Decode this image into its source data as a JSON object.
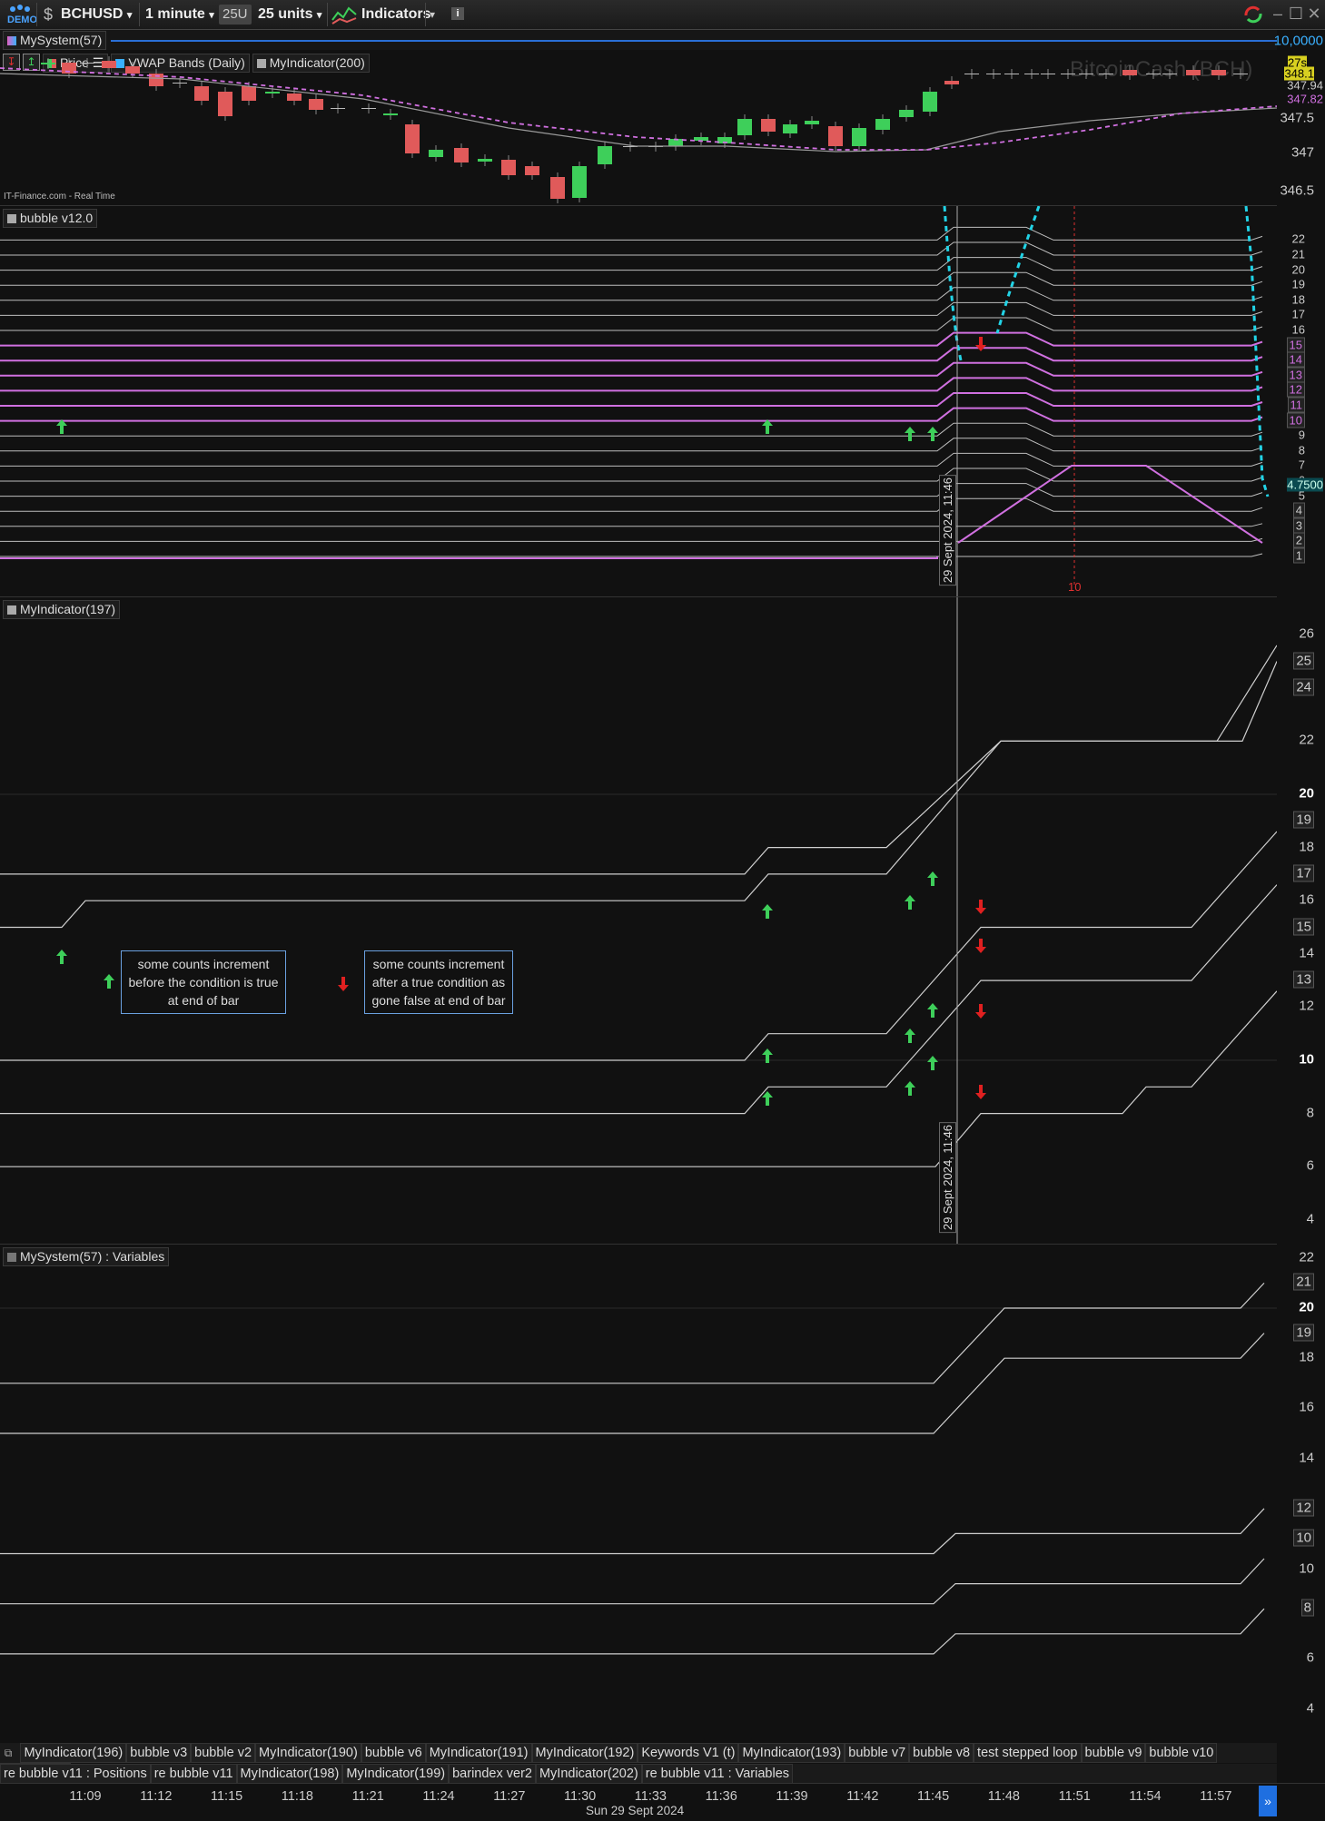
{
  "toolbar": {
    "demo_label": "DEMO",
    "symbol": "BCHUSD",
    "timeframe": "1 minute",
    "units_badge": "25U",
    "units": "25 units",
    "indicators_label": "Indicators",
    "info_label": "i"
  },
  "price_panel": {
    "title": "MySystem(57)",
    "legend_price": "Price",
    "legend_vwap": "VWAP Bands (Daily)",
    "legend_myindicator": "MyIndicator(200)",
    "watermark": "BitcoinCash (BCH)",
    "source": "IT-Finance.com - Real Time",
    "top_right_value": "10,0000",
    "countdown": "27s",
    "price_last": "348.1",
    "price_tag2": "347.94",
    "vwap_tag": "347.82",
    "y_ticks": [
      "347.5",
      "347",
      "346.5"
    ]
  },
  "bubble_panel": {
    "title": "bubble v12.0",
    "y_ticks": [
      "22",
      "21",
      "20",
      "19",
      "18",
      "17",
      "16",
      "15",
      "14",
      "13",
      "12",
      "11",
      "10",
      "9",
      "8",
      "7",
      "6",
      "5",
      "4",
      "3",
      "2",
      "1"
    ],
    "value_tag": "4.7500",
    "date_label": "29 Sept 2024, 11:46",
    "red_marker_label": "10"
  },
  "myindicator_panel": {
    "title": "MyIndicator(197)",
    "y_ticks": [
      "26",
      "25",
      "24",
      "22",
      "20",
      "19",
      "18",
      "17",
      "16",
      "15",
      "14",
      "13",
      "12",
      "10",
      "8",
      "6",
      "4"
    ],
    "date_label": "29 Sept 2024, 11:46",
    "annotation_left": "some counts increment before the condition is true at end of bar",
    "annotation_right": "some counts increment after a true condition as gone false at end of bar"
  },
  "variables_panel": {
    "title": "MySystem(57) : Variables",
    "y_ticks": [
      "22",
      "21",
      "20",
      "19",
      "18",
      "16",
      "14",
      "12",
      "10",
      "10",
      "8",
      "6",
      "4"
    ]
  },
  "tabs_row1": [
    "MyIndicator(196)",
    "bubble v3",
    "bubble v2",
    "MyIndicator(190)",
    "bubble v6",
    "MyIndicator(191)",
    "MyIndicator(192)",
    "Keywords V1 (t)",
    "MyIndicator(193)",
    "bubble v7",
    "bubble v8",
    "test stepped loop",
    "bubble v9",
    "bubble v10",
    "bubble v11"
  ],
  "tabs_row2": [
    "re bubble v11 : Positions",
    "re bubble v11",
    "MyIndicator(198)",
    "MyIndicator(199)",
    "barindex ver2",
    "MyIndicator(202)",
    "re bubble v11 : Variables"
  ],
  "time_axis": {
    "ticks": [
      "11:09",
      "11:12",
      "11:15",
      "11:18",
      "11:21",
      "11:24",
      "11:27",
      "11:30",
      "11:33",
      "11:36",
      "11:39",
      "11:42",
      "11:45",
      "11:48",
      "11:51",
      "11:54",
      "11:57"
    ],
    "date": "Sun 29 Sept 2024"
  },
  "colors": {
    "up_candle": "#3ecf5a",
    "down_candle": "#e05a5a",
    "vwap": "#d070e0",
    "cyan": "#22d3e6",
    "accent_blue": "#2a6fd6"
  }
}
